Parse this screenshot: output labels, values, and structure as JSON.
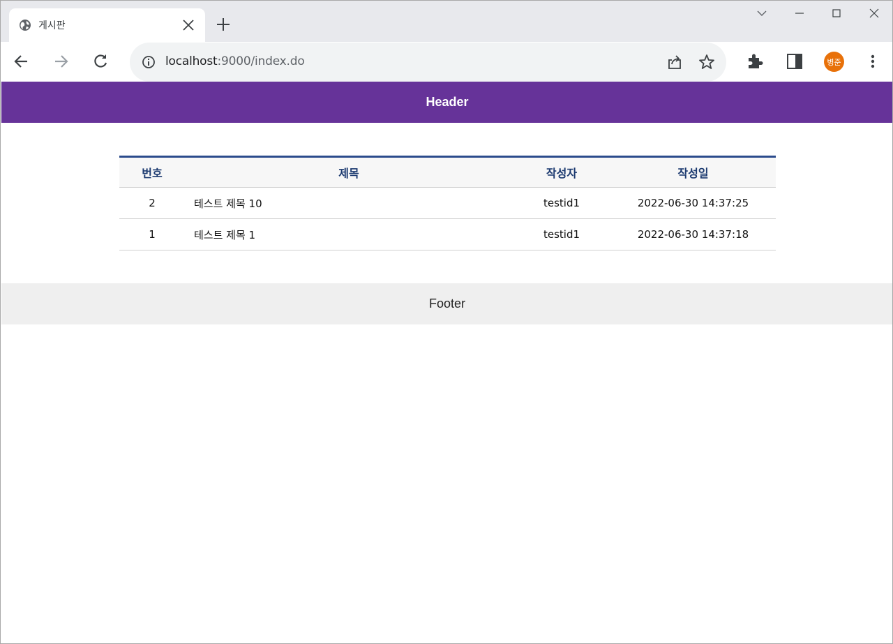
{
  "browser": {
    "tab_title": "게시판",
    "url_host": "localhost",
    "url_rest": ":9000/index.do",
    "profile_initials": "병준"
  },
  "site": {
    "header_text": "Header",
    "footer_text": "Footer"
  },
  "board": {
    "columns": [
      "번호",
      "제목",
      "작성자",
      "작성일"
    ],
    "rows": [
      {
        "no": "2",
        "title": "테스트 제목 10",
        "writer": "testid1",
        "date": "2022-06-30 14:37:25"
      },
      {
        "no": "1",
        "title": "테스트 제목 1",
        "writer": "testid1",
        "date": "2022-06-30 14:37:18"
      }
    ]
  },
  "colors": {
    "header_bg": "#663399",
    "table_accent": "#2b4b8c",
    "avatar_bg": "#e8710a"
  }
}
